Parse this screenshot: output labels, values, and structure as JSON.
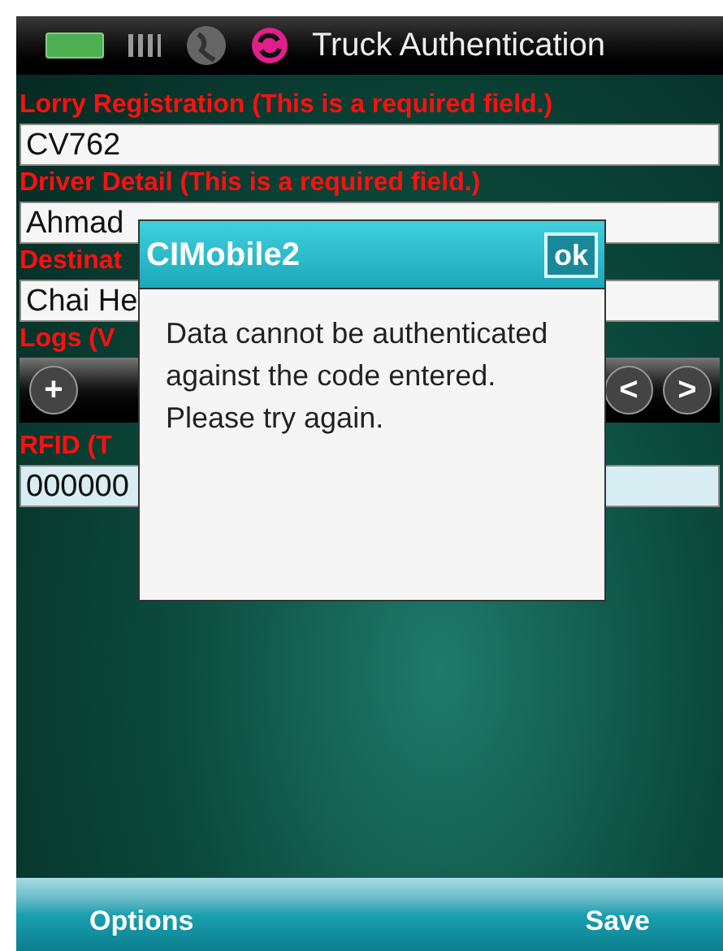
{
  "status_bar": {
    "title": "Truck Authentication"
  },
  "fields": [
    {
      "label": "Lorry Registration (This is a required field.)",
      "value": "CV762"
    },
    {
      "label": "Driver Detail (This is a required field.)",
      "value": "Ahmad"
    },
    {
      "label": "Destinat",
      "value": "Chai He"
    }
  ],
  "logs": {
    "label": "Logs (V",
    "buttons": [
      "+",
      "<",
      ">"
    ]
  },
  "rfid": {
    "label": "RFID (T",
    "value": "000000"
  },
  "dialog": {
    "title": "CIMobile2",
    "ok": "ok",
    "message": "Data cannot be authenticated against the code entered. Please try again."
  },
  "softkeys": [
    "Options",
    "Save"
  ]
}
